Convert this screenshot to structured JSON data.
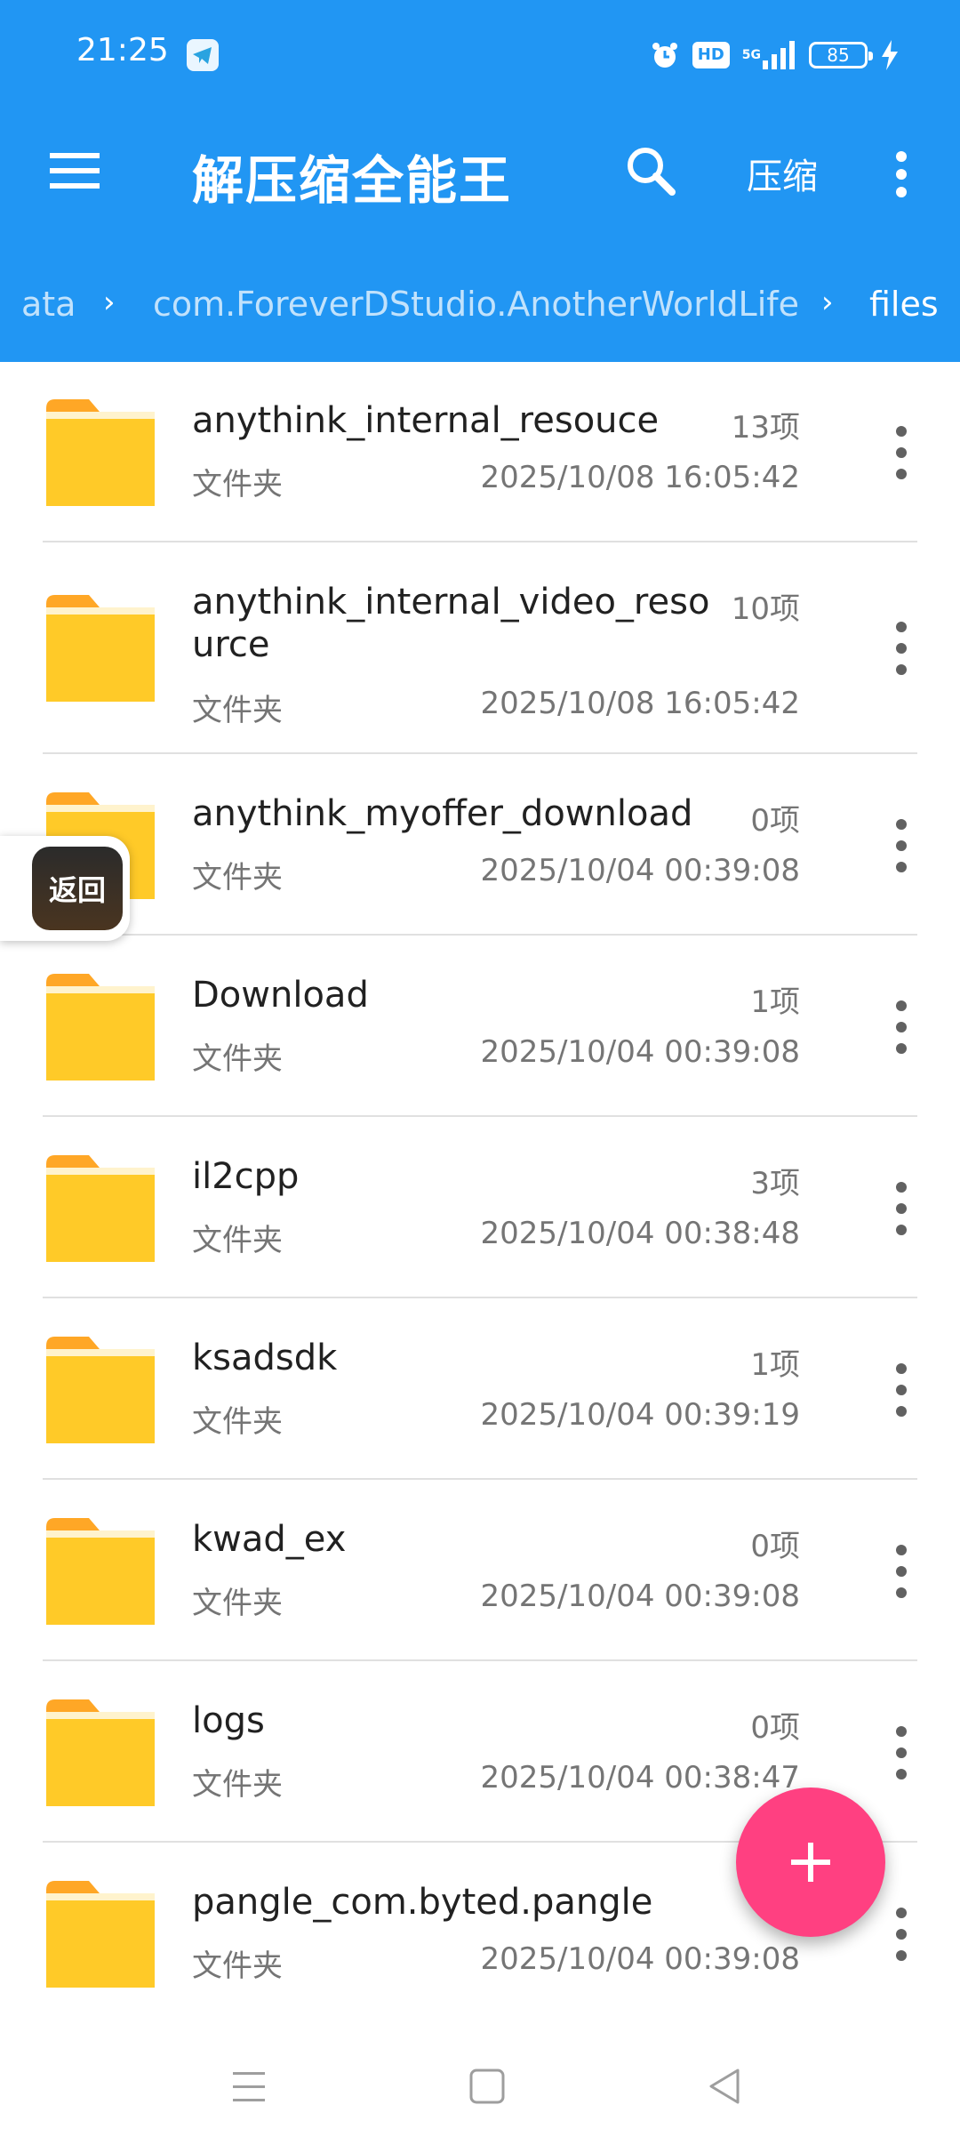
{
  "status_bar": {
    "time": "21:25",
    "hd": "HD",
    "network": "5G",
    "battery": "85",
    "icons": [
      "telegram-icon",
      "alarm-icon",
      "hd-icon",
      "signal-icon",
      "battery-icon",
      "charging-icon"
    ]
  },
  "toolbar": {
    "title": "解压缩全能王",
    "compress_label": "压缩",
    "icons": [
      "menu-icon",
      "search-icon",
      "more-vert-icon"
    ]
  },
  "breadcrumb": [
    "ata",
    "com.ForeverDStudio.AnotherWorldLife",
    "files"
  ],
  "files": [
    {
      "name": "anythink_internal_resouce",
      "count": "13项",
      "type": "文件夹",
      "date": "2025/10/08 16:05:42"
    },
    {
      "name": "anythink_internal_video_resource",
      "count": "10项",
      "type": "文件夹",
      "date": "2025/10/08 16:05:42"
    },
    {
      "name": "anythink_myoffer_download",
      "count": "0项",
      "type": "文件夹",
      "date": "2025/10/04 00:39:08"
    },
    {
      "name": "Download",
      "count": "1项",
      "type": "文件夹",
      "date": "2025/10/04 00:39:08"
    },
    {
      "name": "il2cpp",
      "count": "3项",
      "type": "文件夹",
      "date": "2025/10/04 00:38:48"
    },
    {
      "name": "ksadsdk",
      "count": "1项",
      "type": "文件夹",
      "date": "2025/10/04 00:39:19"
    },
    {
      "name": "kwad_ex",
      "count": "0项",
      "type": "文件夹",
      "date": "2025/10/04 00:39:08"
    },
    {
      "name": "logs",
      "count": "0项",
      "type": "文件夹",
      "date": "2025/10/04 00:38:47"
    },
    {
      "name": "pangle_com.byted.pangle",
      "count": "",
      "type": "文件夹",
      "date": "2025/10/04 00:39:08"
    }
  ],
  "floating_back": {
    "label": "返回"
  },
  "colors": {
    "primary": "#2196F3",
    "fab": "#FF4081",
    "folder": "#FFCA28",
    "folder_tab": "#FFA726"
  }
}
